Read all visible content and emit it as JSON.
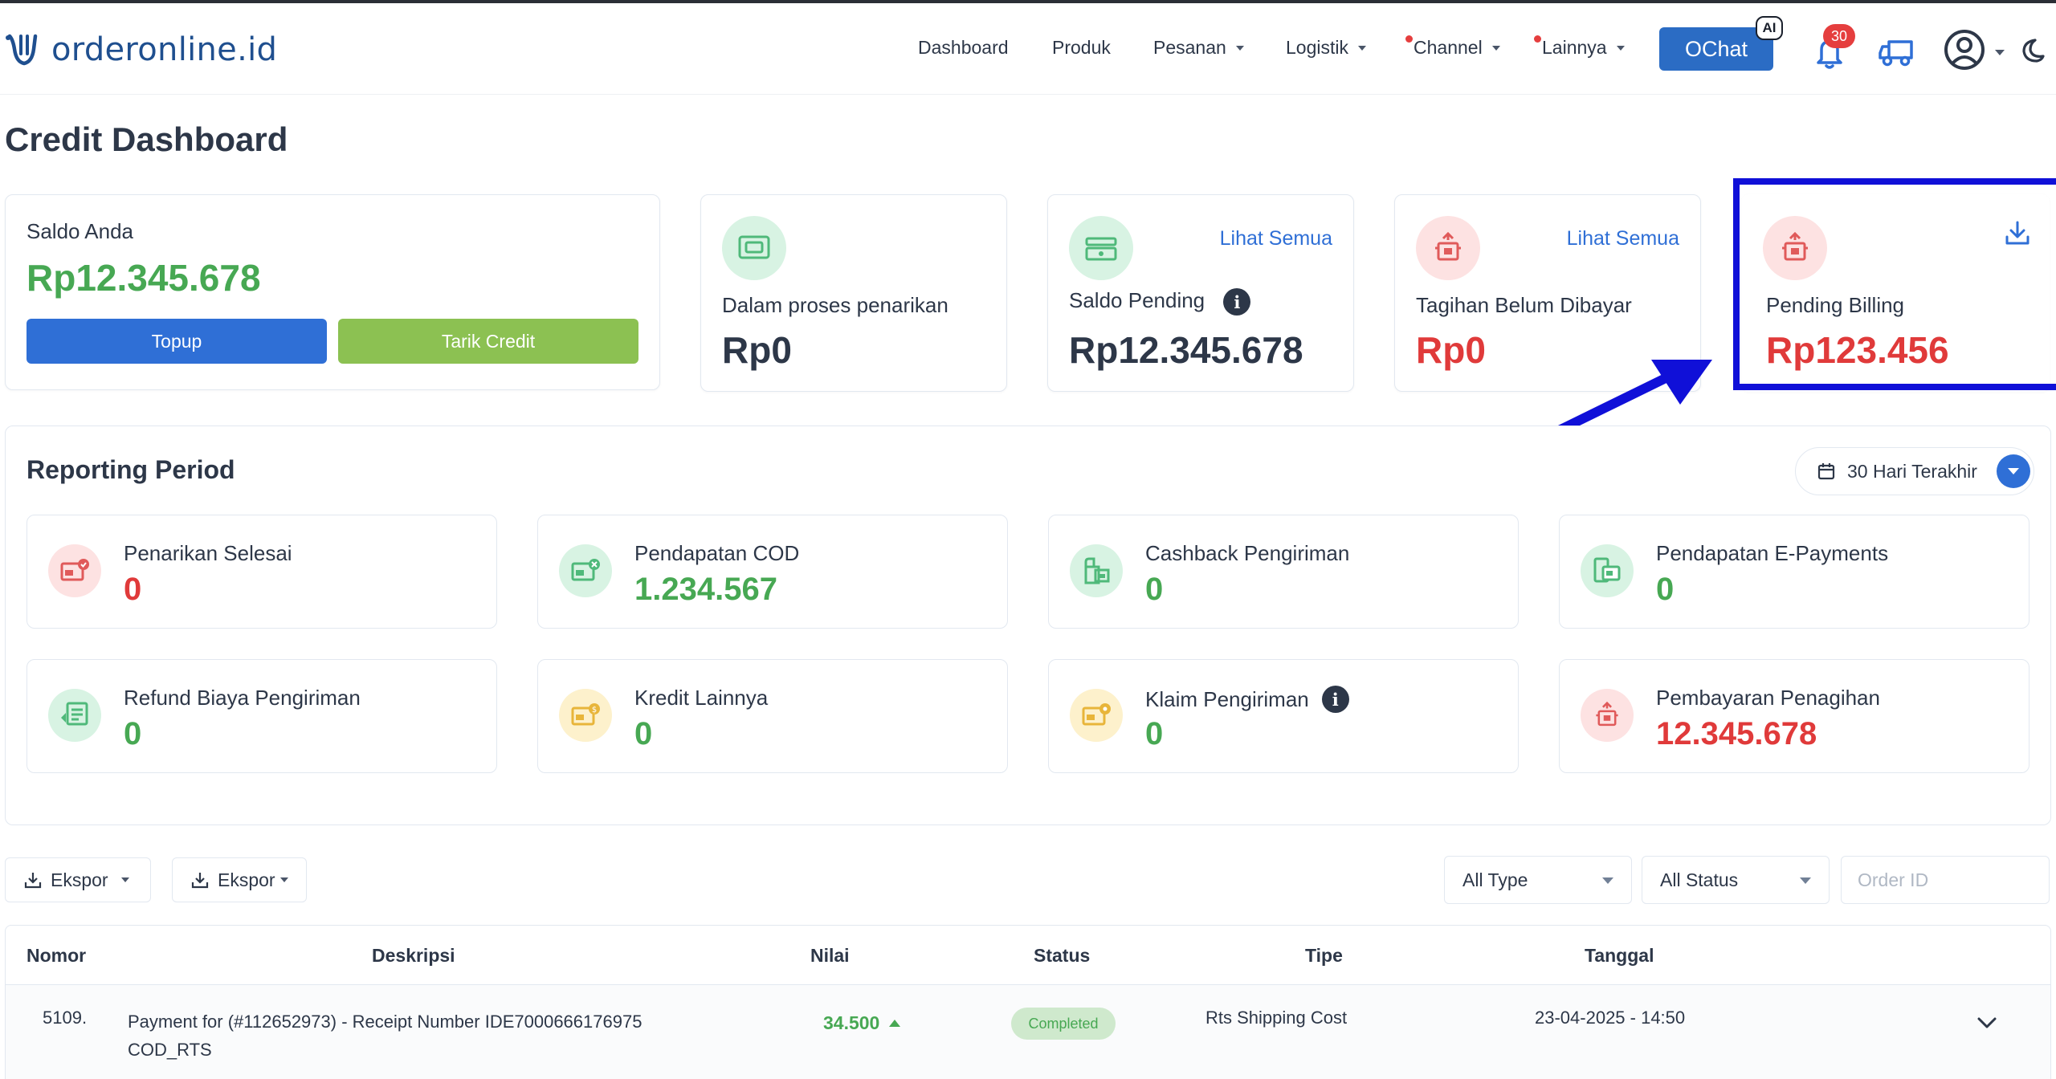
{
  "brand": {
    "logo_text": "orderonline.id"
  },
  "nav": {
    "items": [
      {
        "label": "Dashboard",
        "dropdown": false,
        "dot": false
      },
      {
        "label": "Produk",
        "dropdown": false,
        "dot": false
      },
      {
        "label": "Pesanan",
        "dropdown": true,
        "dot": false
      },
      {
        "label": "Logistik",
        "dropdown": true,
        "dot": false
      },
      {
        "label": "Channel",
        "dropdown": true,
        "dot": true
      },
      {
        "label": "Lainnya",
        "dropdown": true,
        "dot": true
      }
    ],
    "ochat_label": "OChat",
    "ai_badge": "AI",
    "notification_count": "30"
  },
  "page": {
    "title": "Credit Dashboard"
  },
  "balance": {
    "label": "Saldo Anda",
    "value": "Rp12.345.678",
    "topup_label": "Topup",
    "tarik_label": "Tarik Credit"
  },
  "summary_cards": [
    {
      "label": "Dalam proses penarikan",
      "value": "Rp0",
      "link": ""
    },
    {
      "label": "Saldo Pending",
      "value": "Rp12.345.678",
      "link": "Lihat Semua",
      "info": "i"
    },
    {
      "label": "Tagihan Belum Dibayar",
      "value": "Rp0",
      "link": "Lihat Semua"
    },
    {
      "label": "Pending Billing",
      "value": "Rp123.456",
      "link": ""
    }
  ],
  "reporting": {
    "title": "Reporting Period",
    "period": "30 Hari Terakhir",
    "stats": [
      {
        "label": "Penarikan Selesai",
        "value": "0"
      },
      {
        "label": "Pendapatan COD",
        "value": "1.234.567"
      },
      {
        "label": "Cashback Pengiriman",
        "value": "0"
      },
      {
        "label": "Pendapatan E-Payments",
        "value": "0"
      },
      {
        "label": "Refund Biaya Pengiriman",
        "value": "0"
      },
      {
        "label": "Kredit Lainnya",
        "value": "0"
      },
      {
        "label": "Klaim Pengiriman",
        "value": "0",
        "info": "i"
      },
      {
        "label": "Pembayaran Penagihan",
        "value": "12.345.678"
      }
    ]
  },
  "toolbar": {
    "export1_label": "Ekspor",
    "export2_label": "Ekspor",
    "type_filter": "All Type",
    "status_filter": "All Status",
    "order_id_placeholder": "Order ID"
  },
  "table": {
    "columns": [
      "Nomor",
      "Deskripsi",
      "Nilai",
      "Status",
      "Tipe",
      "Tanggal"
    ],
    "rows": [
      {
        "nomor": "5109.",
        "deskripsi_line1": "Payment for (#112652973) - Receipt Number IDE7000666176975",
        "deskripsi_line2": "COD_RTS",
        "nilai": "34.500",
        "status": "Completed",
        "tipe": "Rts Shipping Cost",
        "tanggal": "23-04-2025 - 14:50"
      }
    ]
  },
  "colors": {
    "primary": "#2f6fd6",
    "success": "#47a853",
    "danger": "#e03a3a",
    "tarik": "#8cc152",
    "highlight": "#1010d8"
  }
}
